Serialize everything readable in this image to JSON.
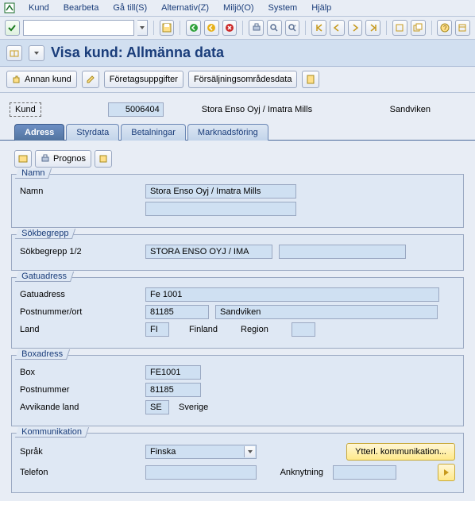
{
  "menu": {
    "items": [
      "Kund",
      "Bearbeta",
      "Gå till(S)",
      "Alternativ(Z)",
      "Miljö(O)",
      "System",
      "Hjälp"
    ]
  },
  "title": "Visa kund: Allmänna data",
  "app_toolbar": {
    "btn1_label": "Annan kund",
    "btn2_label": "Företagsuppgifter",
    "btn3_label": "Försäljningsområdesdata"
  },
  "header": {
    "kund_label": "Kund",
    "kund_value": "5006404",
    "kund_name": "Stora Enso Oyj / Imatra Mills",
    "kund_loc": "Sandviken"
  },
  "tabs": {
    "t0": "Adress",
    "t1": "Styrdata",
    "t2": "Betalningar",
    "t3": "Marknadsföring"
  },
  "inner_toolbar": {
    "prognos_label": "Prognos"
  },
  "grp_namn": {
    "title": "Namn",
    "label": "Namn",
    "value": "Stora Enso Oyj / Imatra Mills"
  },
  "grp_sok": {
    "title": "Sökbegrepp",
    "label": "Sökbegrepp 1/2",
    "value1": "STORA ENSO OYJ / IMA",
    "value2": ""
  },
  "grp_gatu": {
    "title": "Gatuadress",
    "gatu_label": "Gatuadress",
    "gatu_value": "Fe 1001",
    "post_label": "Postnummer/ort",
    "post_value": "81185",
    "ort_value": "Sandviken",
    "land_label": "Land",
    "land_value": "FI",
    "land_name": "Finland",
    "region_label": "Region",
    "region_value": ""
  },
  "grp_box": {
    "title": "Boxadress",
    "box_label": "Box",
    "box_value": "FE1001",
    "post_label": "Postnummer",
    "post_value": "81185",
    "avv_label": "Avvikande land",
    "avv_value": "SE",
    "avv_name": "Sverige"
  },
  "grp_komm": {
    "title": "Kommunikation",
    "sprak_label": "Språk",
    "sprak_value": "Finska",
    "more_btn": "Ytterl. kommunikation...",
    "tel_label": "Telefon",
    "tel_value": "",
    "ankn_label": "Anknytning",
    "ankn_value": ""
  }
}
